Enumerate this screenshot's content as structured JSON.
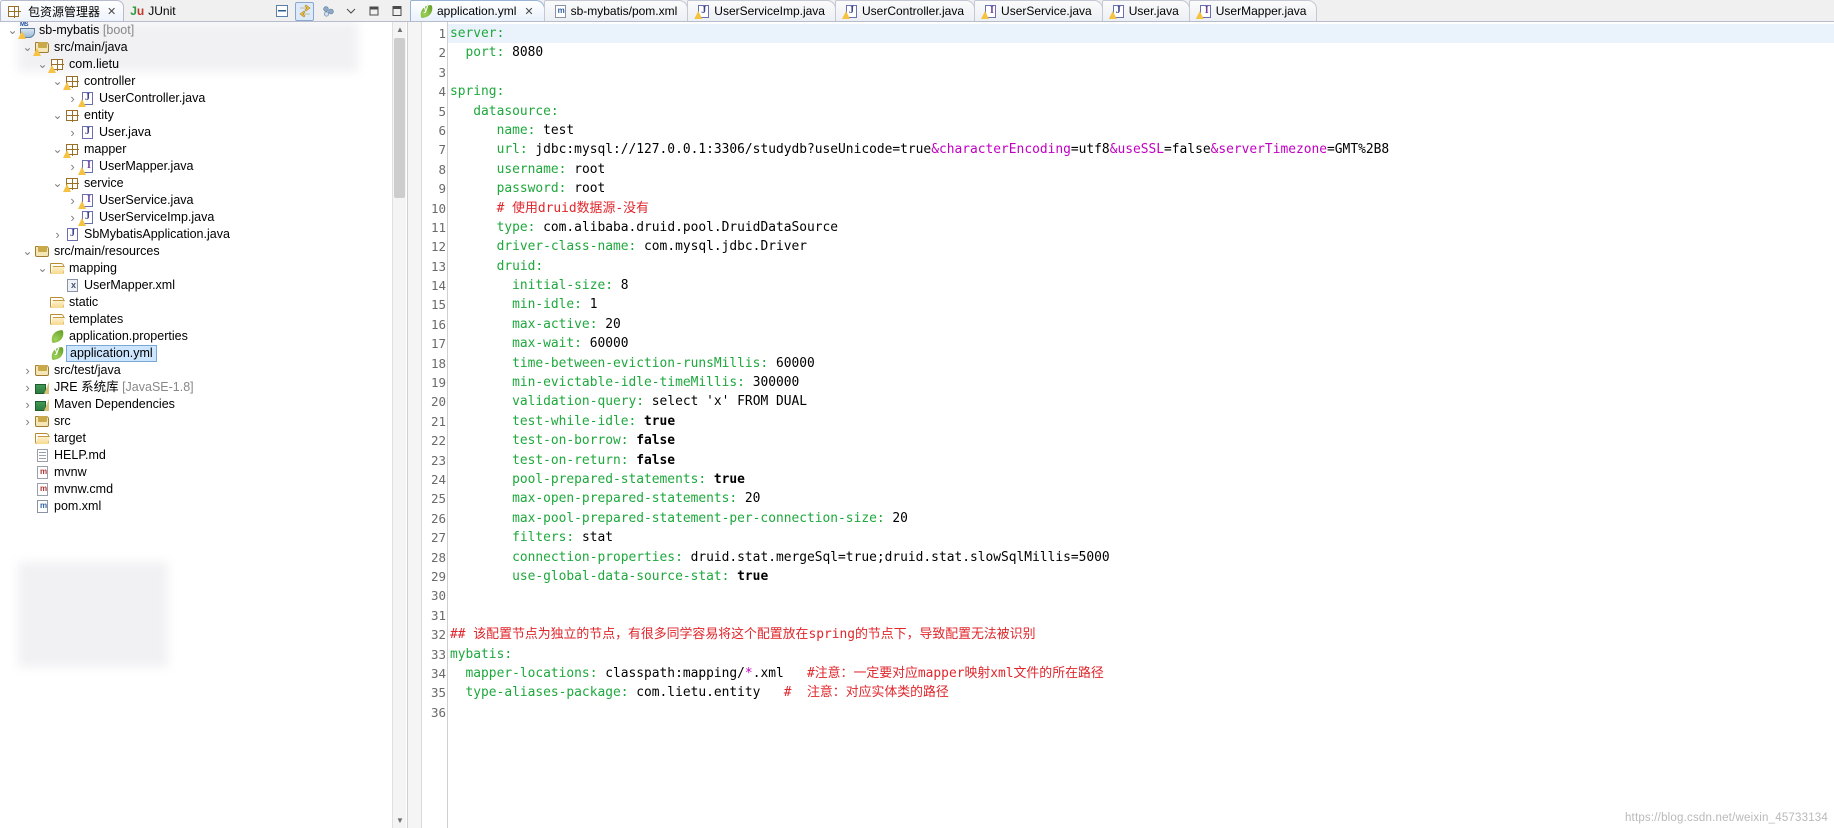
{
  "left_panel": {
    "tabs": [
      {
        "label": "包资源管理器",
        "icon": "package-explorer-icon",
        "active": true,
        "closable": true
      },
      {
        "label": "JUnit",
        "icon": "junit-icon",
        "active": false,
        "closable": false
      }
    ],
    "toolbar": [
      {
        "name": "collapse-all-icon",
        "selected": false
      },
      {
        "name": "link-with-editor-icon",
        "selected": true
      },
      {
        "name": "view-menu-icon",
        "selected": false
      },
      {
        "name": "chevron-down-icon",
        "selected": false
      },
      {
        "name": "minimize-icon",
        "selected": false
      },
      {
        "name": "maximize-icon",
        "selected": false
      }
    ],
    "tree": [
      {
        "indent": 0,
        "arrow": "open",
        "icon": "project-icon",
        "label": "sb-mybatis",
        "suffix": " [boot]",
        "warn": true,
        "selected": false
      },
      {
        "indent": 1,
        "arrow": "open",
        "icon": "source-folder-icon",
        "label": "src/main/java",
        "suffix": "",
        "warn": true,
        "selected": false
      },
      {
        "indent": 2,
        "arrow": "open",
        "icon": "package-icon",
        "label": "com.lietu",
        "suffix": "",
        "warn": true,
        "selected": false
      },
      {
        "indent": 3,
        "arrow": "open",
        "icon": "package-icon",
        "label": "controller",
        "suffix": "",
        "warn": true,
        "selected": false
      },
      {
        "indent": 4,
        "arrow": "closed",
        "icon": "java-class-icon",
        "label": "UserController.java",
        "suffix": "",
        "warn": true,
        "selected": false
      },
      {
        "indent": 3,
        "arrow": "open",
        "icon": "package-icon",
        "label": "entity",
        "suffix": "",
        "warn": false,
        "selected": false
      },
      {
        "indent": 4,
        "arrow": "closed",
        "icon": "java-class-icon",
        "label": "User.java",
        "suffix": "",
        "warn": false,
        "selected": false
      },
      {
        "indent": 3,
        "arrow": "open",
        "icon": "package-icon",
        "label": "mapper",
        "suffix": "",
        "warn": true,
        "selected": false
      },
      {
        "indent": 4,
        "arrow": "closed",
        "icon": "java-interface-icon",
        "label": "UserMapper.java",
        "suffix": "",
        "warn": true,
        "selected": false
      },
      {
        "indent": 3,
        "arrow": "open",
        "icon": "package-icon",
        "label": "service",
        "suffix": "",
        "warn": true,
        "selected": false
      },
      {
        "indent": 4,
        "arrow": "closed",
        "icon": "java-interface-icon",
        "label": "UserService.java",
        "suffix": "",
        "warn": true,
        "selected": false
      },
      {
        "indent": 4,
        "arrow": "closed",
        "icon": "java-class-icon",
        "label": "UserServiceImp.java",
        "suffix": "",
        "warn": true,
        "selected": false
      },
      {
        "indent": 3,
        "arrow": "closed",
        "icon": "java-class-icon",
        "label": "SbMybatisApplication.java",
        "suffix": "",
        "warn": false,
        "selected": false
      },
      {
        "indent": 1,
        "arrow": "open",
        "icon": "source-folder-icon",
        "label": "src/main/resources",
        "suffix": "",
        "warn": false,
        "selected": false
      },
      {
        "indent": 2,
        "arrow": "open",
        "icon": "folder-icon",
        "label": "mapping",
        "suffix": "",
        "warn": false,
        "selected": false
      },
      {
        "indent": 3,
        "arrow": "none",
        "icon": "xml-file-icon",
        "label": "UserMapper.xml",
        "suffix": "",
        "warn": false,
        "selected": false
      },
      {
        "indent": 2,
        "arrow": "none",
        "icon": "folder-icon",
        "label": "static",
        "suffix": "",
        "warn": false,
        "selected": false
      },
      {
        "indent": 2,
        "arrow": "none",
        "icon": "folder-icon",
        "label": "templates",
        "suffix": "",
        "warn": false,
        "selected": false
      },
      {
        "indent": 2,
        "arrow": "none",
        "icon": "properties-file-icon",
        "label": "application.properties",
        "suffix": "",
        "warn": false,
        "selected": false
      },
      {
        "indent": 2,
        "arrow": "none",
        "icon": "yaml-file-icon",
        "label": "application.yml",
        "suffix": "",
        "warn": false,
        "selected": true
      },
      {
        "indent": 1,
        "arrow": "closed",
        "icon": "source-folder-icon",
        "label": "src/test/java",
        "suffix": "",
        "warn": false,
        "selected": false
      },
      {
        "indent": 1,
        "arrow": "closed",
        "icon": "library-icon",
        "label": "JRE 系统库",
        "suffix": " [JavaSE-1.8]",
        "warn": false,
        "selected": false
      },
      {
        "indent": 1,
        "arrow": "closed",
        "icon": "library-icon",
        "label": "Maven Dependencies",
        "suffix": "",
        "warn": false,
        "selected": false
      },
      {
        "indent": 1,
        "arrow": "closed",
        "icon": "source-folder-icon",
        "label": "src",
        "suffix": "",
        "warn": false,
        "selected": false
      },
      {
        "indent": 1,
        "arrow": "none",
        "icon": "folder-icon",
        "label": "target",
        "suffix": "",
        "warn": false,
        "selected": false
      },
      {
        "indent": 1,
        "arrow": "none",
        "icon": "markdown-file-icon",
        "label": "HELP.md",
        "suffix": "",
        "warn": false,
        "selected": false
      },
      {
        "indent": 1,
        "arrow": "none",
        "icon": "maven-wrapper-icon",
        "label": "mvnw",
        "suffix": "",
        "warn": false,
        "selected": false
      },
      {
        "indent": 1,
        "arrow": "none",
        "icon": "maven-wrapper-icon",
        "label": "mvnw.cmd",
        "suffix": "",
        "warn": false,
        "selected": false
      },
      {
        "indent": 1,
        "arrow": "none",
        "icon": "pom-file-icon",
        "label": "pom.xml",
        "suffix": "",
        "warn": false,
        "selected": false
      }
    ]
  },
  "editor": {
    "tabs": [
      {
        "label": "application.yml",
        "icon": "yaml-file-icon",
        "active": true,
        "closable": true
      },
      {
        "label": "sb-mybatis/pom.xml",
        "icon": "pom-file-icon",
        "active": false,
        "closable": false
      },
      {
        "label": "UserServiceImp.java",
        "icon": "java-class-icon",
        "active": false,
        "closable": false
      },
      {
        "label": "UserController.java",
        "icon": "java-class-icon",
        "active": false,
        "closable": false
      },
      {
        "label": "UserService.java",
        "icon": "java-interface-icon",
        "active": false,
        "closable": false
      },
      {
        "label": "User.java",
        "icon": "java-class-icon",
        "active": false,
        "closable": false
      },
      {
        "label": "UserMapper.java",
        "icon": "java-interface-icon",
        "active": false,
        "closable": false
      }
    ],
    "highlighted_line": 1,
    "line_count": 36,
    "lines": [
      {
        "n": 1,
        "segments": [
          {
            "t": "server:",
            "c": "k"
          }
        ]
      },
      {
        "n": 2,
        "segments": [
          {
            "t": "  port: ",
            "c": "k"
          },
          {
            "t": "8080",
            "c": "v"
          }
        ]
      },
      {
        "n": 3,
        "segments": []
      },
      {
        "n": 4,
        "segments": [
          {
            "t": "spring:",
            "c": "k"
          }
        ]
      },
      {
        "n": 5,
        "segments": [
          {
            "t": "   datasource:",
            "c": "k"
          }
        ]
      },
      {
        "n": 6,
        "segments": [
          {
            "t": "      name: ",
            "c": "k"
          },
          {
            "t": "test",
            "c": "v"
          }
        ]
      },
      {
        "n": 7,
        "segments": [
          {
            "t": "      url: ",
            "c": "k"
          },
          {
            "t": "jdbc:mysql://127.0.0.1:3306/studydb?useUnicode=true",
            "c": "v"
          },
          {
            "t": "&characterEncoding",
            "c": "mg"
          },
          {
            "t": "=utf8",
            "c": "v"
          },
          {
            "t": "&useSSL",
            "c": "mg"
          },
          {
            "t": "=false",
            "c": "v"
          },
          {
            "t": "&serverTimezone",
            "c": "mg"
          },
          {
            "t": "=GMT%2B8",
            "c": "v"
          }
        ]
      },
      {
        "n": 8,
        "segments": [
          {
            "t": "      username: ",
            "c": "k"
          },
          {
            "t": "root",
            "c": "v"
          }
        ]
      },
      {
        "n": 9,
        "segments": [
          {
            "t": "      password: ",
            "c": "k"
          },
          {
            "t": "root",
            "c": "v"
          }
        ]
      },
      {
        "n": 10,
        "segments": [
          {
            "t": "      # 使用druid数据源-没有",
            "c": "cm"
          }
        ]
      },
      {
        "n": 11,
        "segments": [
          {
            "t": "      type: ",
            "c": "k"
          },
          {
            "t": "com.alibaba.druid.pool.DruidDataSource",
            "c": "v"
          }
        ]
      },
      {
        "n": 12,
        "segments": [
          {
            "t": "      driver-class-name: ",
            "c": "k"
          },
          {
            "t": "com.mysql.jdbc.Driver",
            "c": "v"
          }
        ]
      },
      {
        "n": 13,
        "segments": [
          {
            "t": "      druid:",
            "c": "k"
          }
        ]
      },
      {
        "n": 14,
        "segments": [
          {
            "t": "        initial-size: ",
            "c": "k"
          },
          {
            "t": "8",
            "c": "v"
          }
        ]
      },
      {
        "n": 15,
        "segments": [
          {
            "t": "        min-idle: ",
            "c": "k"
          },
          {
            "t": "1",
            "c": "v"
          }
        ]
      },
      {
        "n": 16,
        "segments": [
          {
            "t": "        max-active: ",
            "c": "k"
          },
          {
            "t": "20",
            "c": "v"
          }
        ]
      },
      {
        "n": 17,
        "segments": [
          {
            "t": "        max-wait: ",
            "c": "k"
          },
          {
            "t": "60000",
            "c": "v"
          }
        ]
      },
      {
        "n": 18,
        "segments": [
          {
            "t": "        time-between-eviction-runsMillis: ",
            "c": "k"
          },
          {
            "t": "60000",
            "c": "v"
          }
        ]
      },
      {
        "n": 19,
        "segments": [
          {
            "t": "        min-evictable-idle-timeMillis: ",
            "c": "k"
          },
          {
            "t": "300000",
            "c": "v"
          }
        ]
      },
      {
        "n": 20,
        "segments": [
          {
            "t": "        validation-query: ",
            "c": "k"
          },
          {
            "t": "select 'x' FROM DUAL",
            "c": "v"
          }
        ]
      },
      {
        "n": 21,
        "segments": [
          {
            "t": "        test-while-idle: ",
            "c": "k"
          },
          {
            "t": "true",
            "c": "vb"
          }
        ]
      },
      {
        "n": 22,
        "segments": [
          {
            "t": "        test-on-borrow: ",
            "c": "k"
          },
          {
            "t": "false",
            "c": "vb"
          }
        ]
      },
      {
        "n": 23,
        "segments": [
          {
            "t": "        test-on-return: ",
            "c": "k"
          },
          {
            "t": "false",
            "c": "vb"
          }
        ]
      },
      {
        "n": 24,
        "segments": [
          {
            "t": "        pool-prepared-statements: ",
            "c": "k"
          },
          {
            "t": "true",
            "c": "vb"
          }
        ]
      },
      {
        "n": 25,
        "segments": [
          {
            "t": "        max-open-prepared-statements: ",
            "c": "k"
          },
          {
            "t": "20",
            "c": "v"
          }
        ]
      },
      {
        "n": 26,
        "segments": [
          {
            "t": "        max-pool-prepared-statement-per-connection-size: ",
            "c": "k"
          },
          {
            "t": "20",
            "c": "v"
          }
        ]
      },
      {
        "n": 27,
        "segments": [
          {
            "t": "        filters: ",
            "c": "k"
          },
          {
            "t": "stat",
            "c": "v"
          }
        ]
      },
      {
        "n": 28,
        "segments": [
          {
            "t": "        connection-properties: ",
            "c": "k"
          },
          {
            "t": "druid.stat.mergeSql=true;druid.stat.slowSqlMillis=5000",
            "c": "v"
          }
        ]
      },
      {
        "n": 29,
        "segments": [
          {
            "t": "        use-global-data-source-stat: ",
            "c": "k"
          },
          {
            "t": "true",
            "c": "vb"
          }
        ]
      },
      {
        "n": 30,
        "segments": []
      },
      {
        "n": 31,
        "segments": []
      },
      {
        "n": 32,
        "segments": [
          {
            "t": "## 该配置节点为独立的节点，有很多同学容易将这个配置放在spring的节点下，导致配置无法被识别",
            "c": "cm"
          }
        ]
      },
      {
        "n": 33,
        "segments": [
          {
            "t": "mybatis:",
            "c": "k"
          }
        ]
      },
      {
        "n": 34,
        "segments": [
          {
            "t": "  mapper-locations: ",
            "c": "k"
          },
          {
            "t": "classpath:mapping/",
            "c": "v"
          },
          {
            "t": "*",
            "c": "mg"
          },
          {
            "t": ".xml",
            "c": "v"
          },
          {
            "t": "   #注意：一定要对应mapper映射xml文件的所在路径",
            "c": "cm"
          }
        ]
      },
      {
        "n": 35,
        "segments": [
          {
            "t": "  type-aliases-package: ",
            "c": "k"
          },
          {
            "t": "com.lietu.entity",
            "c": "v"
          },
          {
            "t": "   #  注意：对应实体类的路径",
            "c": "cm"
          }
        ]
      },
      {
        "n": 36,
        "segments": []
      }
    ]
  },
  "watermark": "https://blog.csdn.net/weixin_45733134",
  "colors": {
    "yaml_key": "#1ea83c",
    "comment": "#e0262b",
    "param": "#c000c0",
    "selection": "#cde6ff",
    "active_line": "#eaf2fb"
  }
}
